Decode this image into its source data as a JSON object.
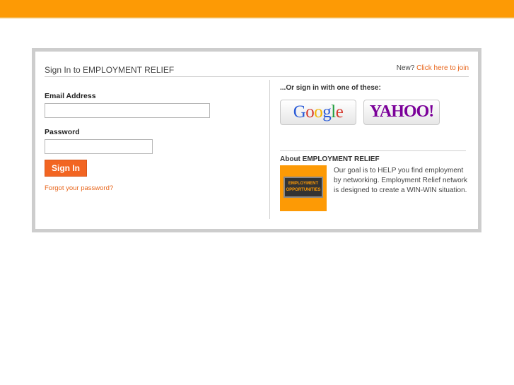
{
  "header": {
    "title": "Sign In to EMPLOYMENT RELIEF",
    "new_prefix": "New? ",
    "join_link": "Click here to join"
  },
  "form": {
    "email_label": "Email Address",
    "email_value": "",
    "password_label": "Password",
    "password_value": "",
    "sign_in": "Sign In",
    "forgot": "Forgot your password?"
  },
  "social": {
    "heading": "...Or sign in with one of these:",
    "google": [
      "G",
      "o",
      "o",
      "g",
      "l",
      "e"
    ],
    "yahoo": "YAHOO!"
  },
  "about": {
    "title": "About EMPLOYMENT RELIEF",
    "image_text": "EMPLOYMENT OPPORTUNITIES",
    "text": "Our goal is to HELP you find employment by networking. Employment Relief network is designed to create a WIN-WIN situation."
  },
  "colors": {
    "brand_orange": "#fd9a05",
    "button_orange": "#f26522",
    "link_orange": "#e8661c",
    "yahoo_purple": "#7b0099"
  }
}
